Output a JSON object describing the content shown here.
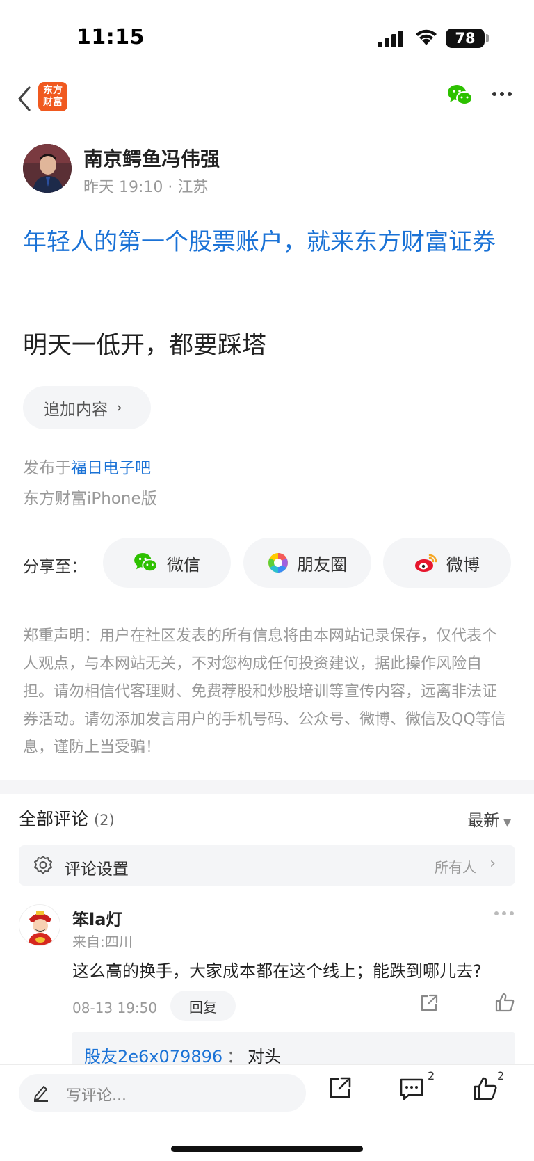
{
  "status_bar": {
    "time": "11:15",
    "battery": "78"
  },
  "nav": {
    "logo_line1": "东方",
    "logo_line2": "财富"
  },
  "author": {
    "name": "南京鳄鱼冯伟强",
    "meta": "昨天 19:10 · 江苏"
  },
  "post": {
    "promo": "年轻人的第一个股票账户，就来东方财富证券",
    "body": "明天一低开，都要踩塔",
    "append_label": "追加内容",
    "published_prefix": "发布于",
    "published_board": "福日电子吧",
    "platform": "东方财富iPhone版"
  },
  "share": {
    "label": "分享至：",
    "options": [
      {
        "label": "微信",
        "icon": "wechat-icon"
      },
      {
        "label": "朋友圈",
        "icon": "moments-icon"
      },
      {
        "label": "微博",
        "icon": "weibo-icon"
      }
    ]
  },
  "disclaimer": "郑重声明：用户在社区发表的所有信息将由本网站记录保存，仅代表个人观点，与本网站无关，不对您构成任何投资建议，据此操作风险自担。请勿相信代客理财、免费荐股和炒股培训等宣传内容，远离非法证券活动。请勿添加发言用户的手机号码、公众号、微博、微信及QQ等信息，谨防上当受骗！",
  "comments": {
    "title": "全部评论",
    "count": "(2)",
    "sort": "最新",
    "settings_label": "评论设置",
    "settings_value": "所有人",
    "items": [
      {
        "name": "笨la灯",
        "location": "来自:四川",
        "text": "这么高的换手，大家成本都在这个线上；能跌到哪儿去?",
        "time": "08-13 19:50",
        "reply_label": "回复",
        "reply": {
          "user": "股友2e6x079896",
          "separator": "：",
          "text": "对头"
        }
      }
    ]
  },
  "bottom_bar": {
    "placeholder": "写评论...",
    "comment_count": "2",
    "like_count": "2"
  },
  "colors": {
    "accent_blue": "#1a72d6",
    "brand_orange": "#f0591f",
    "wechat_green": "#2dc100"
  }
}
